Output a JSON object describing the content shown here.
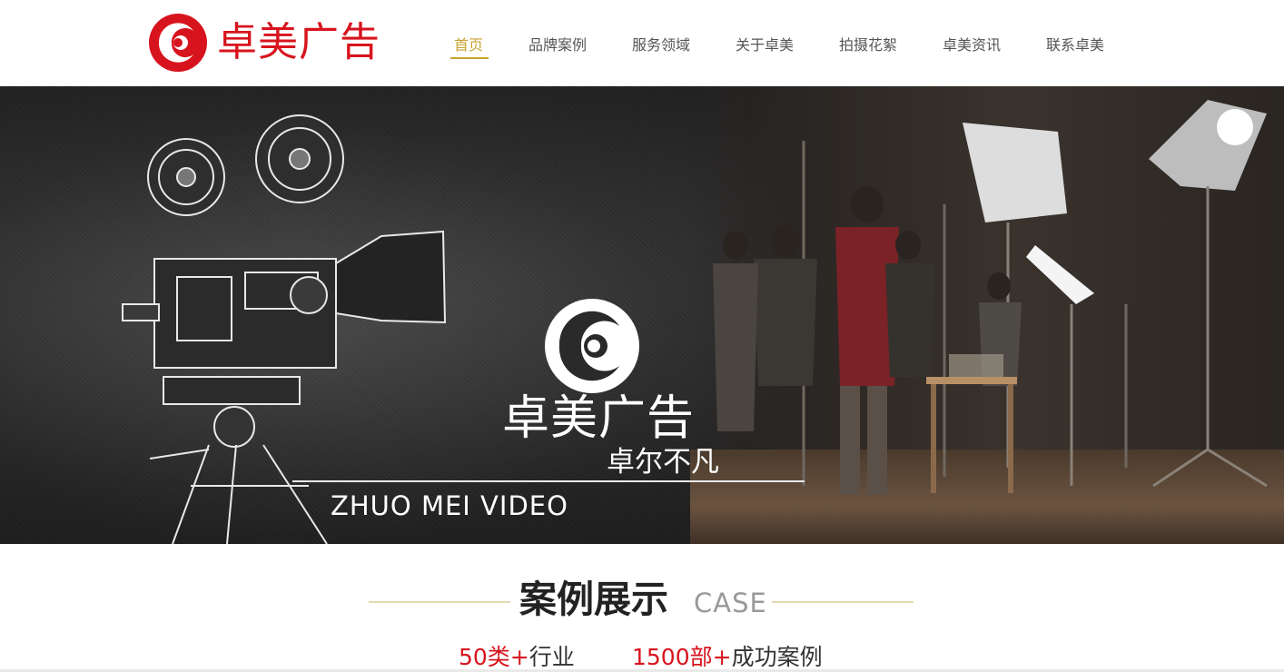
{
  "header": {
    "logo_text": "卓美广告",
    "nav": [
      {
        "label": "首页",
        "active": true
      },
      {
        "label": "品牌案例",
        "active": false
      },
      {
        "label": "服务领域",
        "active": false
      },
      {
        "label": "关于卓美",
        "active": false
      },
      {
        "label": "拍摄花絮",
        "active": false
      },
      {
        "label": "卓美资讯",
        "active": false
      },
      {
        "label": "联系卓美",
        "active": false
      }
    ]
  },
  "banner": {
    "title": "卓美广告",
    "slogan": "卓尔不凡",
    "english": "ZHUO MEI VIDEO"
  },
  "section": {
    "title": "案例展示",
    "title_en": "CASE"
  },
  "stats": [
    {
      "number": "50类+",
      "label": "行业"
    },
    {
      "number": "1500部+",
      "label": "成功案例"
    }
  ],
  "colors": {
    "brand_red": "#d7141d",
    "nav_active": "#c9a332",
    "section_line": "#e6d9b2"
  }
}
